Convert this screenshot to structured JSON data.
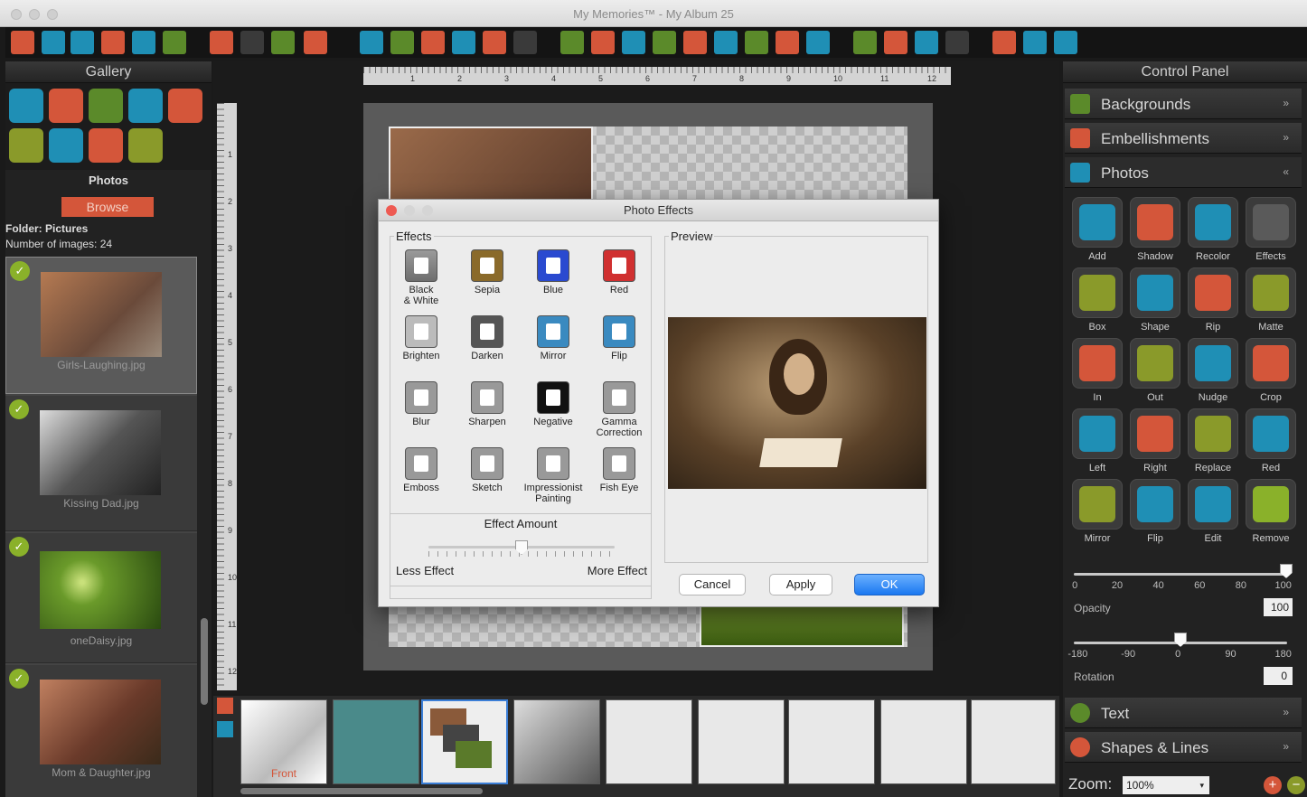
{
  "window": {
    "title": "My Memories™ - My Album 25"
  },
  "gallery": {
    "header": "Gallery",
    "section_title": "Photos",
    "browse_label": "Browse",
    "folder": "Folder: Pictures",
    "count": "Number of images: 24",
    "photos": [
      {
        "name": "Girls-Laughing.jpg",
        "color": "#9a6a4a"
      },
      {
        "name": "Kissing Dad.jpg",
        "color": "#6a6a6a"
      },
      {
        "name": "oneDaisy.jpg",
        "color": "#4e7a1e"
      },
      {
        "name": "Mom & Daughter.jpg",
        "color": "#8a5a3a"
      }
    ]
  },
  "ruler": {
    "h": [
      "1",
      "2",
      "3",
      "4",
      "5",
      "6",
      "7",
      "8",
      "9",
      "10",
      "11",
      "12"
    ],
    "v": [
      "1",
      "2",
      "3",
      "4",
      "5",
      "6",
      "7",
      "8",
      "9",
      "10",
      "11",
      "12"
    ]
  },
  "filmstrip": {
    "front_label": "Front"
  },
  "control_panel": {
    "header": "Control Panel",
    "sections": {
      "backgrounds": "Backgrounds",
      "embellishments": "Embellishments",
      "photos": "Photos",
      "text": "Text",
      "shapes": "Shapes & Lines"
    },
    "buttons": [
      {
        "label": "Add",
        "color": "#1f8fb5",
        "icon": "camera-icon"
      },
      {
        "label": "Shadow",
        "color": "#d4563a",
        "icon": "shadow-icon"
      },
      {
        "label": "Recolor",
        "color": "#1f8fb5",
        "icon": "drops-icon"
      },
      {
        "label": "Effects",
        "color": "#5a5a5a",
        "icon": "wand-icon"
      },
      {
        "label": "Box",
        "color": "#8a9a2a",
        "icon": "box-icon"
      },
      {
        "label": "Shape",
        "color": "#1f8fb5",
        "icon": "shape-icon"
      },
      {
        "label": "Rip",
        "color": "#d4563a",
        "icon": "rip-icon"
      },
      {
        "label": "Matte",
        "color": "#8a9a2a",
        "icon": "matte-icon"
      },
      {
        "label": "In",
        "color": "#d4563a",
        "icon": "zoom-in-icon"
      },
      {
        "label": "Out",
        "color": "#8a9a2a",
        "icon": "zoom-out-icon"
      },
      {
        "label": "Nudge",
        "color": "#1f8fb5",
        "icon": "nudge-icon"
      },
      {
        "label": "Crop",
        "color": "#d4563a",
        "icon": "crop-icon"
      },
      {
        "label": "Left",
        "color": "#1f8fb5",
        "icon": "rotate-left-icon"
      },
      {
        "label": "Right",
        "color": "#d4563a",
        "icon": "rotate-right-icon"
      },
      {
        "label": "Replace",
        "color": "#8a9a2a",
        "icon": "replace-icon"
      },
      {
        "label": "Red",
        "color": "#1f8fb5",
        "icon": "eye-icon"
      },
      {
        "label": "Mirror",
        "color": "#8a9a2a",
        "icon": "mirror-icon"
      },
      {
        "label": "Flip",
        "color": "#1f8fb5",
        "icon": "flip-icon"
      },
      {
        "label": "Edit",
        "color": "#1f8fb5",
        "icon": "edit-icon"
      },
      {
        "label": "Remove",
        "color": "#8ab12a",
        "icon": "remove-icon"
      }
    ],
    "opacity": {
      "label": "Opacity",
      "value": "100",
      "ticks": [
        "0",
        "20",
        "40",
        "60",
        "80",
        "100"
      ]
    },
    "rotation": {
      "label": "Rotation",
      "value": "0",
      "ticks": [
        "-180",
        "-90",
        "0",
        "90",
        "180"
      ]
    },
    "zoom": {
      "label": "Zoom:",
      "value": "100%"
    }
  },
  "dialog": {
    "title": "Photo Effects",
    "effects_label": "Effects",
    "preview_label": "Preview",
    "effects": [
      {
        "line1": "Black",
        "line2": "& White"
      },
      {
        "line1": "Sepia",
        "line2": ""
      },
      {
        "line1": "Blue",
        "line2": ""
      },
      {
        "line1": "Red",
        "line2": ""
      },
      {
        "line1": "Brighten",
        "line2": ""
      },
      {
        "line1": "Darken",
        "line2": ""
      },
      {
        "line1": "Mirror",
        "line2": ""
      },
      {
        "line1": "Flip",
        "line2": ""
      },
      {
        "line1": "Blur",
        "line2": ""
      },
      {
        "line1": "Sharpen",
        "line2": ""
      },
      {
        "line1": "Negative",
        "line2": ""
      },
      {
        "line1": "Gamma",
        "line2": "Correction"
      },
      {
        "line1": "Emboss",
        "line2": ""
      },
      {
        "line1": "Sketch",
        "line2": ""
      },
      {
        "line1": "Impressionist",
        "line2": "Painting"
      },
      {
        "line1": "Fish Eye",
        "line2": ""
      }
    ],
    "effect_amount": "Effect Amount",
    "less": "Less Effect",
    "more": "More Effect",
    "amount_value": 0.5,
    "cancel": "Cancel",
    "apply": "Apply",
    "ok": "OK"
  }
}
